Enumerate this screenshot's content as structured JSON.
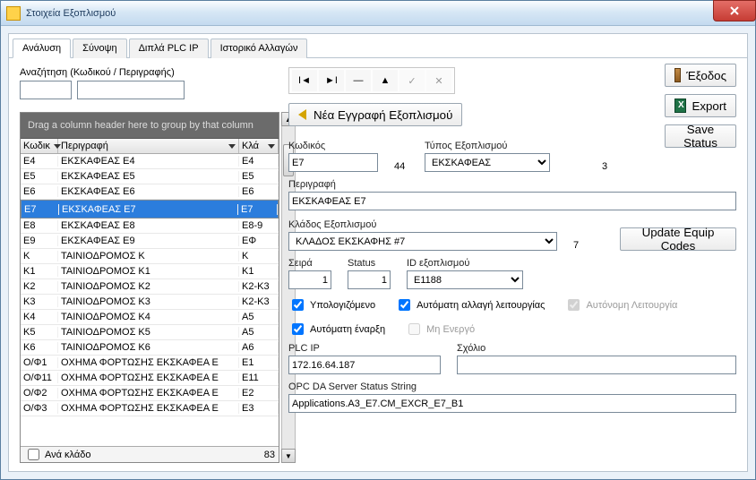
{
  "window": {
    "title": "Στοιχεία Εξοπλισμού"
  },
  "tabs": [
    {
      "label": "Ανάλυση",
      "active": true
    },
    {
      "label": "Σύνοψη"
    },
    {
      "label": "Διπλά PLC IP"
    },
    {
      "label": "Ιστορικό Αλλαγών"
    }
  ],
  "search": {
    "label": "Αναζήτηση (Κωδικού / Περιγραφής)",
    "code": "",
    "desc": ""
  },
  "grid": {
    "group_hint": "Drag a column header here to group by that column",
    "columns": [
      "Κωδικ",
      "Περιγραφή",
      "Κλά"
    ],
    "rows": [
      [
        "E4",
        "ΕΚΣΚΑΦΕΑΣ Ε4",
        "E4"
      ],
      [
        "E5",
        "ΕΚΣΚΑΦΕΑΣ Ε5",
        "E5"
      ],
      [
        "E6",
        "ΕΚΣΚΑΦΕΑΣ Ε6",
        "E6"
      ],
      [
        "E7",
        "ΕΚΣΚΑΦΕΑΣ Ε7",
        "E7"
      ],
      [
        "E8",
        "ΕΚΣΚΑΦΕΑΣ Ε8",
        "E8-9"
      ],
      [
        "E9",
        "ΕΚΣΚΑΦΕΑΣ Ε9",
        "ΕΦ"
      ],
      [
        "K",
        "ΤΑΙΝΙΟΔΡΟΜΟΣ K",
        "K"
      ],
      [
        "K1",
        "ΤΑΙΝΙΟΔΡΟΜΟΣ K1",
        "K1"
      ],
      [
        "K2",
        "ΤΑΙΝΙΟΔΡΟΜΟΣ K2",
        "K2-K3"
      ],
      [
        "K3",
        "ΤΑΙΝΙΟΔΡΟΜΟΣ K3",
        "K2-K3"
      ],
      [
        "K4",
        "ΤΑΙΝΙΟΔΡΟΜΟΣ K4",
        "A5"
      ],
      [
        "K5",
        "ΤΑΙΝΙΟΔΡΟΜΟΣ K5",
        "A5"
      ],
      [
        "K6",
        "ΤΑΙΝΙΟΔΡΟΜΟΣ K6",
        "A6"
      ],
      [
        "Ο/Φ1",
        "ΟΧΗΜΑ ΦΟΡΤΩΣΗΣ ΕΚΣΚΑΦΕΑ Ε",
        "E1"
      ],
      [
        "Ο/Φ11",
        "ΟΧΗΜΑ ΦΟΡΤΩΣΗΣ ΕΚΣΚΑΦΕΑ Ε",
        "E11"
      ],
      [
        "Ο/Φ2",
        "ΟΧΗΜΑ ΦΟΡΤΩΣΗΣ ΕΚΣΚΑΦΕΑ Ε",
        "E2"
      ],
      [
        "Ο/Φ3",
        "ΟΧΗΜΑ ΦΟΡΤΩΣΗΣ ΕΚΣΚΑΦΕΑ Ε",
        "E3"
      ]
    ],
    "selected_index": 3,
    "per_branch_label": "Ανά κλάδο",
    "total": "83"
  },
  "actions": {
    "exit": "Έξοδος",
    "export": "Export",
    "save_status": "Save Status",
    "update_equip": "Update Equip Codes",
    "new_record": "Νέα Εγγραφή Εξοπλισμού"
  },
  "form": {
    "code_label": "Κωδικός",
    "code": "E7",
    "code_num": "44",
    "type_label": "Τύπος Εξοπλισμού",
    "type": "ΕΚΣΚΑΦΕΑΣ",
    "type_num": "3",
    "desc_label": "Περιγραφή",
    "desc": "ΕΚΣΚΑΦΕΑΣ Ε7",
    "branch_label": "Κλάδος Εξοπλισμού",
    "branch": "ΚΛΑΔΟΣ ΕΚΣΚΑΦΗΣ #7",
    "branch_num": "7",
    "series_label": "Σειρά",
    "series": "1",
    "status_label": "Status",
    "status": "1",
    "equip_id_label": "ID εξοπλισμού",
    "equip_id": "E1188",
    "chk_computed": "Υπολογιζόμενο",
    "chk_auto_mode": "Αυτόματη αλλαγή λειτουργίας",
    "chk_autonomous": "Αυτόνομη Λειτουργία",
    "chk_auto_start": "Αυτόματη έναρξη",
    "chk_inactive": "Μη Ενεργό",
    "plc_label": "PLC IP",
    "plc": "172.16.64.187",
    "comment_label": "Σχόλιο",
    "comment": "",
    "opc_label": "OPC DA Server Status String",
    "opc": "Applications.A3_E7.CM_EXCR_E7_B1"
  }
}
